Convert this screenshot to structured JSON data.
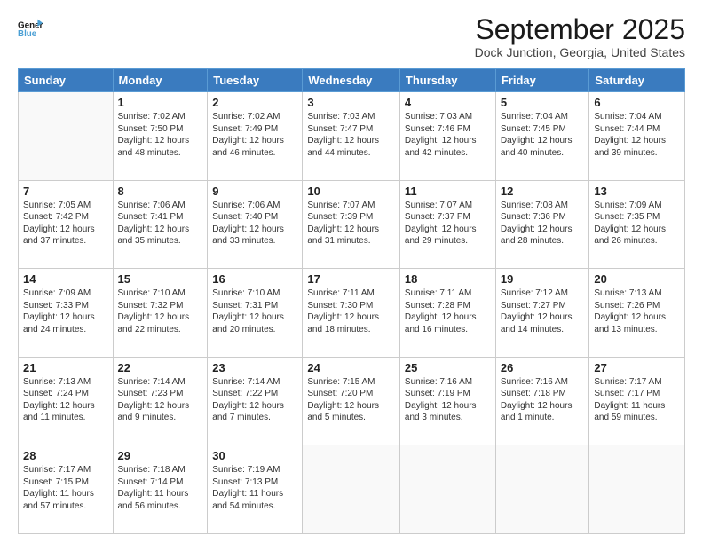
{
  "logo": {
    "line1": "General",
    "line2": "Blue",
    "icon": "▶"
  },
  "title": "September 2025",
  "subtitle": "Dock Junction, Georgia, United States",
  "days_of_week": [
    "Sunday",
    "Monday",
    "Tuesday",
    "Wednesday",
    "Thursday",
    "Friday",
    "Saturday"
  ],
  "weeks": [
    [
      {
        "day": "",
        "sunrise": "",
        "sunset": "",
        "daylight": ""
      },
      {
        "day": "1",
        "sunrise": "Sunrise: 7:02 AM",
        "sunset": "Sunset: 7:50 PM",
        "daylight": "Daylight: 12 hours and 48 minutes."
      },
      {
        "day": "2",
        "sunrise": "Sunrise: 7:02 AM",
        "sunset": "Sunset: 7:49 PM",
        "daylight": "Daylight: 12 hours and 46 minutes."
      },
      {
        "day": "3",
        "sunrise": "Sunrise: 7:03 AM",
        "sunset": "Sunset: 7:47 PM",
        "daylight": "Daylight: 12 hours and 44 minutes."
      },
      {
        "day": "4",
        "sunrise": "Sunrise: 7:03 AM",
        "sunset": "Sunset: 7:46 PM",
        "daylight": "Daylight: 12 hours and 42 minutes."
      },
      {
        "day": "5",
        "sunrise": "Sunrise: 7:04 AM",
        "sunset": "Sunset: 7:45 PM",
        "daylight": "Daylight: 12 hours and 40 minutes."
      },
      {
        "day": "6",
        "sunrise": "Sunrise: 7:04 AM",
        "sunset": "Sunset: 7:44 PM",
        "daylight": "Daylight: 12 hours and 39 minutes."
      }
    ],
    [
      {
        "day": "7",
        "sunrise": "Sunrise: 7:05 AM",
        "sunset": "Sunset: 7:42 PM",
        "daylight": "Daylight: 12 hours and 37 minutes."
      },
      {
        "day": "8",
        "sunrise": "Sunrise: 7:06 AM",
        "sunset": "Sunset: 7:41 PM",
        "daylight": "Daylight: 12 hours and 35 minutes."
      },
      {
        "day": "9",
        "sunrise": "Sunrise: 7:06 AM",
        "sunset": "Sunset: 7:40 PM",
        "daylight": "Daylight: 12 hours and 33 minutes."
      },
      {
        "day": "10",
        "sunrise": "Sunrise: 7:07 AM",
        "sunset": "Sunset: 7:39 PM",
        "daylight": "Daylight: 12 hours and 31 minutes."
      },
      {
        "day": "11",
        "sunrise": "Sunrise: 7:07 AM",
        "sunset": "Sunset: 7:37 PM",
        "daylight": "Daylight: 12 hours and 29 minutes."
      },
      {
        "day": "12",
        "sunrise": "Sunrise: 7:08 AM",
        "sunset": "Sunset: 7:36 PM",
        "daylight": "Daylight: 12 hours and 28 minutes."
      },
      {
        "day": "13",
        "sunrise": "Sunrise: 7:09 AM",
        "sunset": "Sunset: 7:35 PM",
        "daylight": "Daylight: 12 hours and 26 minutes."
      }
    ],
    [
      {
        "day": "14",
        "sunrise": "Sunrise: 7:09 AM",
        "sunset": "Sunset: 7:33 PM",
        "daylight": "Daylight: 12 hours and 24 minutes."
      },
      {
        "day": "15",
        "sunrise": "Sunrise: 7:10 AM",
        "sunset": "Sunset: 7:32 PM",
        "daylight": "Daylight: 12 hours and 22 minutes."
      },
      {
        "day": "16",
        "sunrise": "Sunrise: 7:10 AM",
        "sunset": "Sunset: 7:31 PM",
        "daylight": "Daylight: 12 hours and 20 minutes."
      },
      {
        "day": "17",
        "sunrise": "Sunrise: 7:11 AM",
        "sunset": "Sunset: 7:30 PM",
        "daylight": "Daylight: 12 hours and 18 minutes."
      },
      {
        "day": "18",
        "sunrise": "Sunrise: 7:11 AM",
        "sunset": "Sunset: 7:28 PM",
        "daylight": "Daylight: 12 hours and 16 minutes."
      },
      {
        "day": "19",
        "sunrise": "Sunrise: 7:12 AM",
        "sunset": "Sunset: 7:27 PM",
        "daylight": "Daylight: 12 hours and 14 minutes."
      },
      {
        "day": "20",
        "sunrise": "Sunrise: 7:13 AM",
        "sunset": "Sunset: 7:26 PM",
        "daylight": "Daylight: 12 hours and 13 minutes."
      }
    ],
    [
      {
        "day": "21",
        "sunrise": "Sunrise: 7:13 AM",
        "sunset": "Sunset: 7:24 PM",
        "daylight": "Daylight: 12 hours and 11 minutes."
      },
      {
        "day": "22",
        "sunrise": "Sunrise: 7:14 AM",
        "sunset": "Sunset: 7:23 PM",
        "daylight": "Daylight: 12 hours and 9 minutes."
      },
      {
        "day": "23",
        "sunrise": "Sunrise: 7:14 AM",
        "sunset": "Sunset: 7:22 PM",
        "daylight": "Daylight: 12 hours and 7 minutes."
      },
      {
        "day": "24",
        "sunrise": "Sunrise: 7:15 AM",
        "sunset": "Sunset: 7:20 PM",
        "daylight": "Daylight: 12 hours and 5 minutes."
      },
      {
        "day": "25",
        "sunrise": "Sunrise: 7:16 AM",
        "sunset": "Sunset: 7:19 PM",
        "daylight": "Daylight: 12 hours and 3 minutes."
      },
      {
        "day": "26",
        "sunrise": "Sunrise: 7:16 AM",
        "sunset": "Sunset: 7:18 PM",
        "daylight": "Daylight: 12 hours and 1 minute."
      },
      {
        "day": "27",
        "sunrise": "Sunrise: 7:17 AM",
        "sunset": "Sunset: 7:17 PM",
        "daylight": "Daylight: 11 hours and 59 minutes."
      }
    ],
    [
      {
        "day": "28",
        "sunrise": "Sunrise: 7:17 AM",
        "sunset": "Sunset: 7:15 PM",
        "daylight": "Daylight: 11 hours and 57 minutes."
      },
      {
        "day": "29",
        "sunrise": "Sunrise: 7:18 AM",
        "sunset": "Sunset: 7:14 PM",
        "daylight": "Daylight: 11 hours and 56 minutes."
      },
      {
        "day": "30",
        "sunrise": "Sunrise: 7:19 AM",
        "sunset": "Sunset: 7:13 PM",
        "daylight": "Daylight: 11 hours and 54 minutes."
      },
      {
        "day": "",
        "sunrise": "",
        "sunset": "",
        "daylight": ""
      },
      {
        "day": "",
        "sunrise": "",
        "sunset": "",
        "daylight": ""
      },
      {
        "day": "",
        "sunrise": "",
        "sunset": "",
        "daylight": ""
      },
      {
        "day": "",
        "sunrise": "",
        "sunset": "",
        "daylight": ""
      }
    ]
  ]
}
